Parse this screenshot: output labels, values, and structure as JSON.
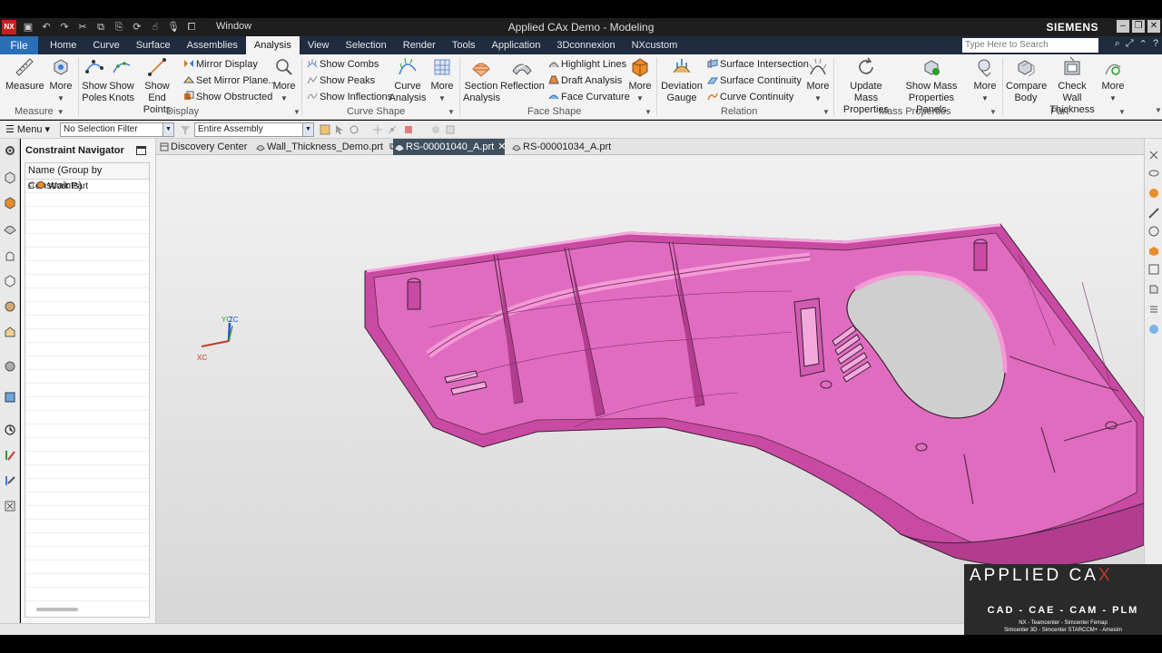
{
  "window": {
    "title": "Applied CAx Demo - Modeling",
    "brand": "SIEMENS",
    "window_menu": "Window"
  },
  "menu": {
    "file": "File",
    "tabs": [
      "Home",
      "Curve",
      "Surface",
      "Assemblies",
      "Analysis",
      "View",
      "Selection",
      "Render",
      "Tools",
      "Application",
      "3Dconnexion",
      "NXcustom"
    ],
    "active_tab": "Analysis",
    "search_placeholder": "Type Here to Search"
  },
  "ribbon": {
    "measure": {
      "label": "Measure",
      "more": "More",
      "group": "Measure"
    },
    "display": {
      "show_poles": [
        "Show",
        "Poles"
      ],
      "show_knots": [
        "Show",
        "Knots"
      ],
      "show_end_points": [
        "Show End",
        "Points"
      ],
      "mirror_display": "Mirror Display",
      "set_mirror_plane": "Set Mirror Plane...",
      "show_obstructed": "Show Obstructed",
      "more": "More",
      "group": "Display"
    },
    "curve_shape": {
      "show_combs": "Show Combs",
      "show_peaks": "Show Peaks",
      "show_inflections": "Show Inflections",
      "curve_analysis": [
        "Curve",
        "Analysis"
      ],
      "more": "More",
      "group": "Curve Shape"
    },
    "face_shape": {
      "section_analysis": [
        "Section",
        "Analysis"
      ],
      "reflection": "Reflection",
      "highlight_lines": "Highlight Lines",
      "draft_analysis": "Draft Analysis",
      "face_curvature": "Face Curvature",
      "more": "More",
      "group": "Face Shape"
    },
    "relation": {
      "deviation_gauge": [
        "Deviation",
        "Gauge"
      ],
      "surface_intersection": "Surface Intersection",
      "surface_continuity": "Surface Continuity",
      "curve_continuity": "Curve Continuity",
      "more": "More",
      "group": "Relation"
    },
    "mass_properties": {
      "update_mass": [
        "Update Mass",
        "Properties"
      ],
      "show_mass_panels": [
        "Show Mass",
        "Properties Panels"
      ],
      "more": "More",
      "group": "Mass Properties"
    },
    "part": {
      "compare_body": [
        "Compare",
        "Body"
      ],
      "check_wall": [
        "Check Wall",
        "Thickness"
      ],
      "more": "More",
      "group": "Part"
    }
  },
  "selection_bar": {
    "menu": "Menu",
    "filter": "No Selection Filter",
    "scope": "Entire Assembly"
  },
  "navigator": {
    "title": "Constraint Navigator",
    "column": "Name (Group by Constraints)",
    "root": "Work Part"
  },
  "doc_tabs": [
    {
      "label": "Discovery Center"
    },
    {
      "label": "Wall_Thickness_Demo.prt"
    },
    {
      "label": "RS-00001040_A.prt"
    },
    {
      "label": "RS-00001034_A.prt"
    }
  ],
  "active_doc": "RS-00001040_A.prt",
  "triad": {
    "x": "XC",
    "y": "YC",
    "z": "ZC"
  },
  "watermark": {
    "logo": "APPLIED CA",
    "logo_x": "X",
    "line1": "CAD - CAE - CAM - PLM",
    "line2": "NX - Teamcenter - Simcenter Femap",
    "line3": "Simcenter 3D - Simcenter STARCCM+ - Amesim"
  },
  "colors": {
    "model": "#d65fb2",
    "model_edge": "#3a2233",
    "accent": "#2a6fb5",
    "menubar": "#1f2c3f"
  }
}
